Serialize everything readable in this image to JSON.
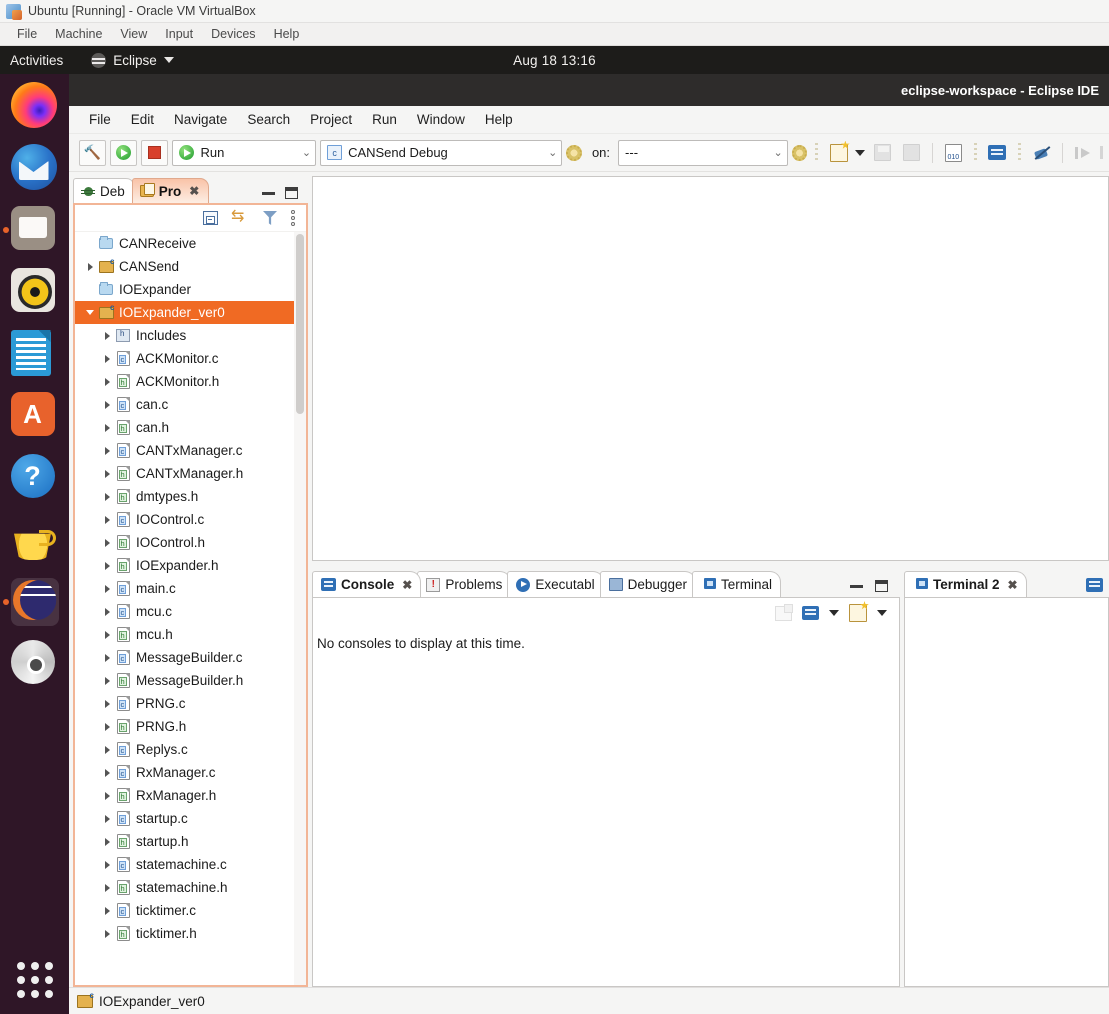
{
  "vbox": {
    "title": "Ubuntu [Running] - Oracle VM VirtualBox",
    "menu": [
      "File",
      "Machine",
      "View",
      "Input",
      "Devices",
      "Help"
    ]
  },
  "ubuntu": {
    "activities": "Activities",
    "app_indicator": "Eclipse",
    "clock": "Aug 18  13:16",
    "dock": [
      {
        "name": "firefox",
        "label": "Firefox"
      },
      {
        "name": "thunderbird",
        "label": "Thunderbird Mail"
      },
      {
        "name": "files",
        "label": "Files"
      },
      {
        "name": "rhythmbox",
        "label": "Rhythmbox"
      },
      {
        "name": "libreoffice-writer",
        "label": "LibreOffice Writer"
      },
      {
        "name": "ubuntu-software",
        "label": "Ubuntu Software"
      },
      {
        "name": "help",
        "label": "Help"
      },
      {
        "name": "amazon",
        "label": "Amazon"
      },
      {
        "name": "eclipse",
        "label": "Eclipse"
      },
      {
        "name": "cd-drive",
        "label": "CD Drive"
      },
      {
        "name": "show-applications",
        "label": "Show Applications"
      }
    ]
  },
  "eclipse": {
    "window_title": "eclipse-workspace - Eclipse IDE",
    "menu": [
      "File",
      "Edit",
      "Navigate",
      "Search",
      "Project",
      "Run",
      "Window",
      "Help"
    ],
    "toolbar": {
      "build_icon": "hammer-icon",
      "run_icon": "run-icon",
      "stop_icon": "stop-icon",
      "mode_combo": "Run",
      "config_combo": "CANSend Debug",
      "on_label": "on:",
      "target_combo": "---"
    },
    "left_view": {
      "tabs": [
        {
          "label": "Deb",
          "icon": "bug-icon",
          "active": false
        },
        {
          "label": "Pro",
          "icon": "project-icon",
          "active": true,
          "closable": true
        }
      ],
      "toolbar_icons": [
        "collapse-all-icon",
        "link-with-editor-icon",
        "filter-icon",
        "view-menu-icon"
      ],
      "tree": [
        {
          "label": "CANReceive",
          "icon": "folder-closed-project",
          "indent": 0,
          "twisty": "none"
        },
        {
          "label": "CANSend",
          "icon": "c-project",
          "indent": 0,
          "twisty": "closed"
        },
        {
          "label": "IOExpander",
          "icon": "folder-closed-project",
          "indent": 0,
          "twisty": "none"
        },
        {
          "label": "IOExpander_ver0",
          "icon": "c-project",
          "indent": 0,
          "twisty": "open",
          "selected": true
        },
        {
          "label": "Includes",
          "icon": "includes",
          "indent": 1,
          "twisty": "closed"
        },
        {
          "label": "ACKMonitor.c",
          "icon": "c-file",
          "indent": 1,
          "twisty": "closed"
        },
        {
          "label": "ACKMonitor.h",
          "icon": "h-file",
          "indent": 1,
          "twisty": "closed"
        },
        {
          "label": "can.c",
          "icon": "c-file",
          "indent": 1,
          "twisty": "closed"
        },
        {
          "label": "can.h",
          "icon": "h-file",
          "indent": 1,
          "twisty": "closed"
        },
        {
          "label": "CANTxManager.c",
          "icon": "c-file",
          "indent": 1,
          "twisty": "closed"
        },
        {
          "label": "CANTxManager.h",
          "icon": "h-file",
          "indent": 1,
          "twisty": "closed"
        },
        {
          "label": "dmtypes.h",
          "icon": "h-file",
          "indent": 1,
          "twisty": "closed"
        },
        {
          "label": "IOControl.c",
          "icon": "c-file",
          "indent": 1,
          "twisty": "closed"
        },
        {
          "label": "IOControl.h",
          "icon": "h-file",
          "indent": 1,
          "twisty": "closed"
        },
        {
          "label": "IOExpander.h",
          "icon": "h-file",
          "indent": 1,
          "twisty": "closed"
        },
        {
          "label": "main.c",
          "icon": "c-file",
          "indent": 1,
          "twisty": "closed"
        },
        {
          "label": "mcu.c",
          "icon": "c-file",
          "indent": 1,
          "twisty": "closed"
        },
        {
          "label": "mcu.h",
          "icon": "h-file",
          "indent": 1,
          "twisty": "closed"
        },
        {
          "label": "MessageBuilder.c",
          "icon": "c-file",
          "indent": 1,
          "twisty": "closed"
        },
        {
          "label": "MessageBuilder.h",
          "icon": "h-file",
          "indent": 1,
          "twisty": "closed"
        },
        {
          "label": "PRNG.c",
          "icon": "c-file",
          "indent": 1,
          "twisty": "closed"
        },
        {
          "label": "PRNG.h",
          "icon": "h-file",
          "indent": 1,
          "twisty": "closed"
        },
        {
          "label": "Replys.c",
          "icon": "c-file",
          "indent": 1,
          "twisty": "closed"
        },
        {
          "label": "RxManager.c",
          "icon": "c-file",
          "indent": 1,
          "twisty": "closed"
        },
        {
          "label": "RxManager.h",
          "icon": "h-file",
          "indent": 1,
          "twisty": "closed"
        },
        {
          "label": "startup.c",
          "icon": "c-file",
          "indent": 1,
          "twisty": "closed"
        },
        {
          "label": "startup.h",
          "icon": "h-file",
          "indent": 1,
          "twisty": "closed"
        },
        {
          "label": "statemachine.c",
          "icon": "c-file",
          "indent": 1,
          "twisty": "closed"
        },
        {
          "label": "statemachine.h",
          "icon": "h-file",
          "indent": 1,
          "twisty": "closed"
        },
        {
          "label": "ticktimer.c",
          "icon": "c-file",
          "indent": 1,
          "twisty": "closed"
        },
        {
          "label": "ticktimer.h",
          "icon": "h-file",
          "indent": 1,
          "twisty": "closed"
        }
      ]
    },
    "bottom_panels": {
      "console_tabs": [
        {
          "label": "Console",
          "icon": "console-icon",
          "active": true,
          "closable": true
        },
        {
          "label": "Problems",
          "icon": "problems-icon",
          "active": false
        },
        {
          "label": "Executabl",
          "icon": "executables-icon",
          "active": false
        },
        {
          "label": "Debugger",
          "icon": "debugger-console-icon",
          "active": false
        },
        {
          "label": "Terminal",
          "icon": "terminal-icon",
          "active": false
        }
      ],
      "console_message": "No consoles to display at this time.",
      "terminal_tab": {
        "label": "Terminal 2",
        "icon": "terminal-icon",
        "closable": true
      }
    },
    "status_bar": {
      "project": "IOExpander_ver0"
    }
  },
  "colors": {
    "selection": "#f06a23",
    "tab_active": "#f9c3a8",
    "panel_border": "#f2b596",
    "topbar": "#1d1c1a",
    "dock": "#270d1e"
  }
}
